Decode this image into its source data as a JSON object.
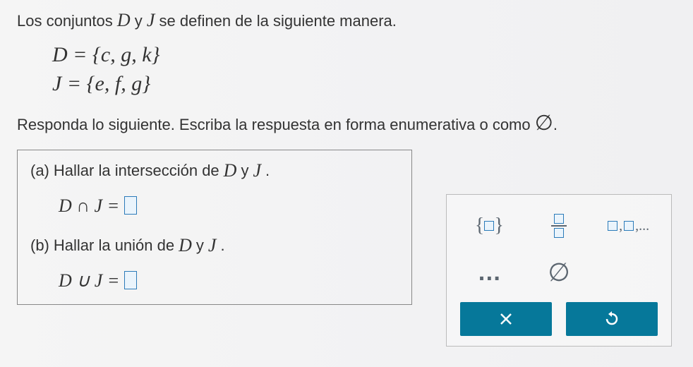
{
  "intro": {
    "prefix": "Los conjuntos ",
    "var1": "D",
    "mid": " y ",
    "var2": "J",
    "suffix": " se definen de la siguiente manera."
  },
  "sets": {
    "D": "D = {c, g, k}",
    "J": "J = {e, f, g}"
  },
  "instruction": {
    "text": "Responda lo siguiente. Escriba la respuesta en forma enumerativa o como ",
    "symbol": "∅",
    "period": "."
  },
  "parts": {
    "a": {
      "label": "(a)",
      "prompt_prefix": "Hallar la intersección de ",
      "var1": "D",
      "mid": " y ",
      "var2": "J",
      "period": ".",
      "expr_lhs": "D ∩ J ="
    },
    "b": {
      "label": "(b)",
      "prompt_prefix": "Hallar la unión de ",
      "var1": "D",
      "mid": " y ",
      "var2": "J",
      "period": ".",
      "expr_lhs": "D ∪ J ="
    }
  },
  "toolbar": {
    "braces": "{□}",
    "frac": "□/□",
    "seq": "□,□,...",
    "dots": "…",
    "empty": "∅",
    "close": "✕",
    "undo": "↺"
  }
}
